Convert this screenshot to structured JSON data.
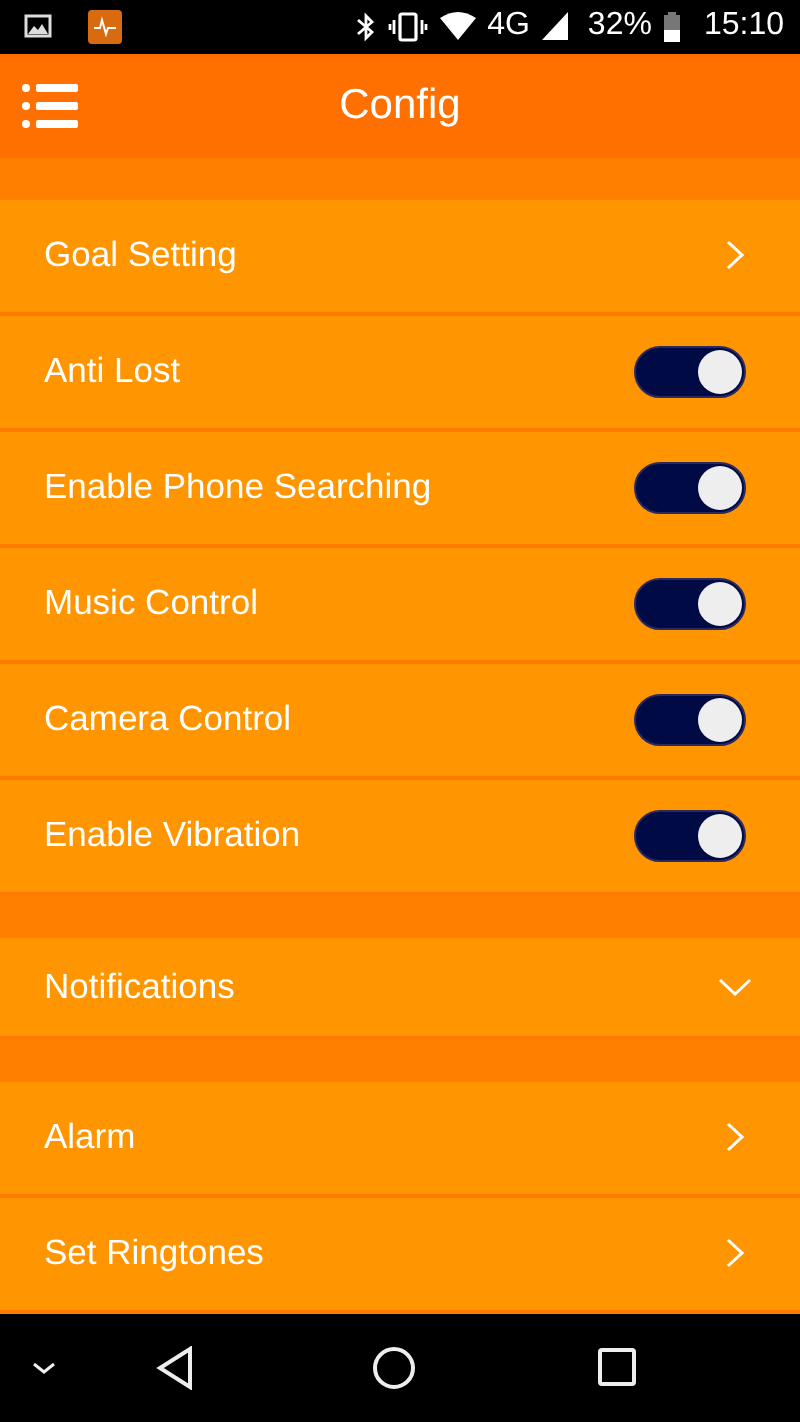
{
  "status_bar": {
    "battery": "32%",
    "network": "4G",
    "time": "15:10"
  },
  "app_bar": {
    "title": "Config"
  },
  "sections": [
    {
      "items": [
        {
          "kind": "link",
          "label": "Goal Setting"
        },
        {
          "kind": "toggle",
          "label": "Anti Lost",
          "on": true
        },
        {
          "kind": "toggle",
          "label": "Enable Phone Searching",
          "on": true
        },
        {
          "kind": "toggle",
          "label": "Music Control",
          "on": true
        },
        {
          "kind": "toggle",
          "label": "Camera Control",
          "on": true
        },
        {
          "kind": "toggle",
          "label": "Enable Vibration",
          "on": true
        }
      ]
    },
    {
      "items": [
        {
          "kind": "expand",
          "label": "Notifications",
          "expanded": false
        }
      ]
    },
    {
      "items": [
        {
          "kind": "link",
          "label": "Alarm"
        },
        {
          "kind": "link",
          "label": "Set Ringtones"
        }
      ]
    }
  ]
}
